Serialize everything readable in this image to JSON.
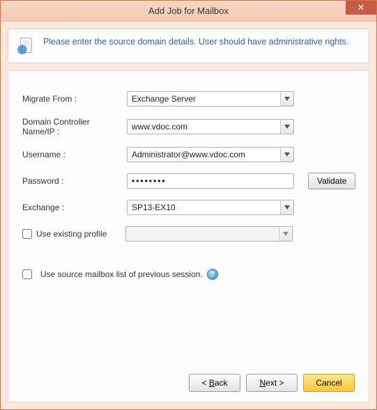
{
  "window": {
    "title": "Add Job for Mailbox"
  },
  "info": {
    "text": "Please enter the source domain details. User should have administrative rights."
  },
  "form": {
    "migrate_from": {
      "label": "Migrate From :",
      "value": "Exchange Server"
    },
    "domain_controller": {
      "label": "Domain Controller Name/IP :",
      "value": "www.vdoc.com"
    },
    "username": {
      "label": "Username :",
      "value": "Administrator@www.vdoc.com"
    },
    "password": {
      "label": "Password :",
      "value": "••••••••"
    },
    "validate_label": "Validate",
    "exchange": {
      "label": "Exchange :",
      "value": "SP13-EX10"
    },
    "use_existing_profile": {
      "label": "Use existing profile",
      "value": ""
    },
    "use_prev_session": {
      "label": "Use source mailbox list of previous session."
    }
  },
  "footer": {
    "back": "Back",
    "next": "Next >",
    "cancel": "Cancel"
  }
}
